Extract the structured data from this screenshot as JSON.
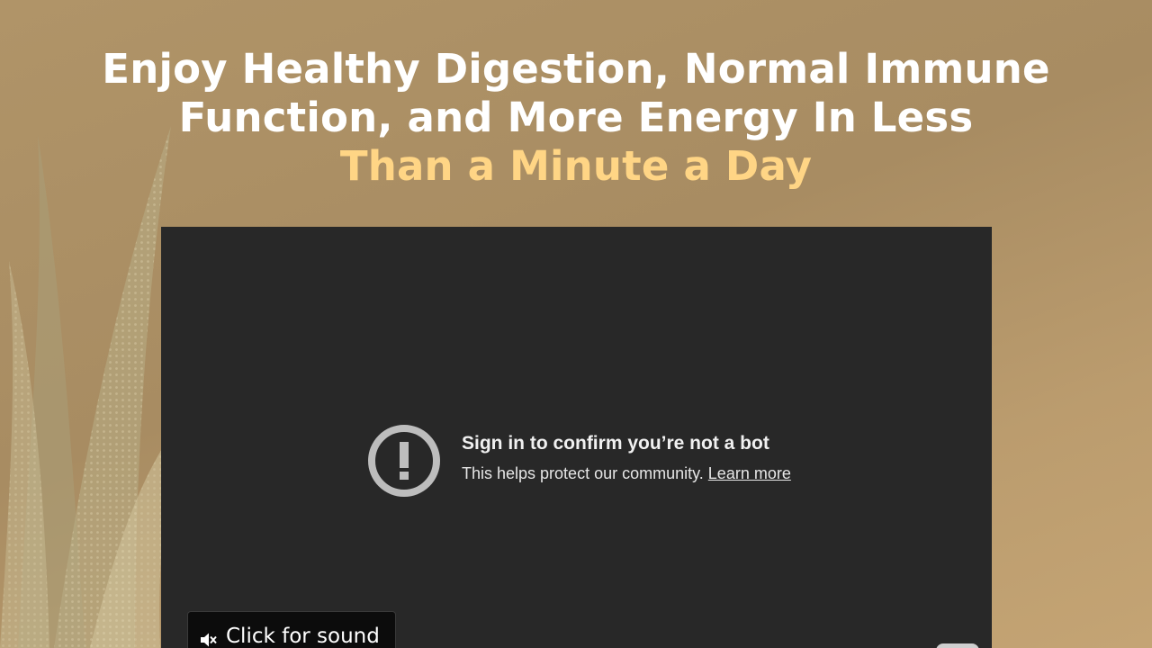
{
  "headline": {
    "line1": "Enjoy Healthy Digestion, Normal Immune",
    "line2": "Function, and More Energy In Less",
    "line3_accent": "Than a Minute a Day"
  },
  "video": {
    "error_title": "Sign in to confirm you’re not a bot",
    "error_message": "This helps protect our community.",
    "learn_more_label": "Learn more"
  },
  "sound_button": {
    "label": "Click for sound",
    "icon": "muted-speaker-icon"
  },
  "colors": {
    "accent": "#ffd585",
    "video_bg": "#282828",
    "headline": "#ffffff"
  }
}
